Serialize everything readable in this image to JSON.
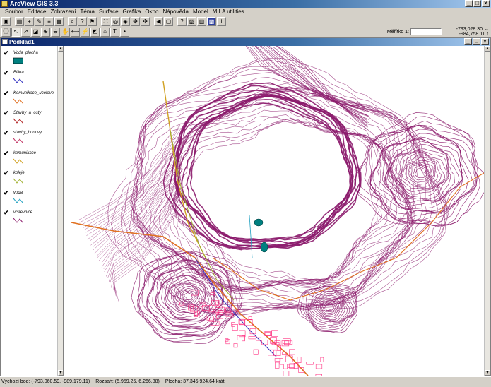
{
  "app": {
    "title": "ArcView GIS 3.3"
  },
  "menu": [
    "Soubor",
    "Editace",
    "Zobrazení",
    "Téma",
    "Surface",
    "Grafika",
    "Okno",
    "Nápověda",
    "Model",
    "MILA utilities"
  ],
  "toolbar": {
    "scale_label": "Měřítko 1:",
    "scale_value": "",
    "coord_x": "-793,028.30",
    "coord_y": "-984,758.11",
    "coord_x_arrow": "↔",
    "coord_y_arrow": "↕"
  },
  "view": {
    "title": "Podklad1",
    "themes": [
      {
        "name": "Voda_plocha",
        "color": "#008080",
        "kind": "fill"
      },
      {
        "name": "Bilina",
        "color": "#3030c0",
        "kind": "line"
      },
      {
        "name": "Komunikace_ucelove",
        "color": "#e07020",
        "kind": "line"
      },
      {
        "name": "Stavby_a_osty",
        "color": "#b02020",
        "kind": "line"
      },
      {
        "name": "stavby_budovy",
        "color": "#c03060",
        "kind": "line"
      },
      {
        "name": "komunikace",
        "color": "#d0a020",
        "kind": "line"
      },
      {
        "name": "koleje",
        "color": "#a0b030",
        "kind": "line"
      },
      {
        "name": "voda",
        "color": "#20a0c0",
        "kind": "line"
      },
      {
        "name": "vrstevnice",
        "color": "#8b1a6b",
        "kind": "line"
      }
    ]
  },
  "status": {
    "origin": "Výchozí bod: (-793,060.59, -989,179.11)",
    "extent": "Rozsah: (5,959.25, 6,266.88)",
    "area": "Plocha: 37,345,924.64 krát"
  },
  "colors": {
    "contour": "#8b1a6b",
    "road": "#e07020",
    "building": "#ff3080",
    "water": "#008080"
  }
}
